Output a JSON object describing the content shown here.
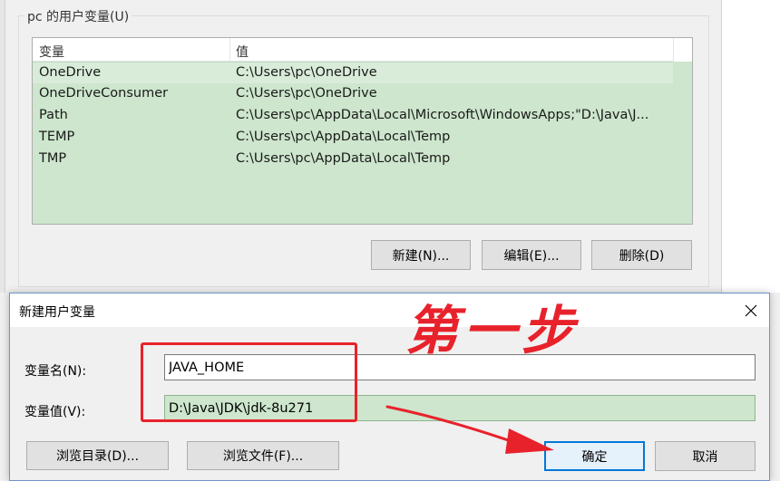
{
  "background_window": {
    "group_title": "pc 的用户变量(U)",
    "columns": {
      "name": "变量",
      "value": "值"
    },
    "rows": [
      {
        "name": "OneDrive",
        "value": "C:\\Users\\pc\\OneDrive",
        "selected": true
      },
      {
        "name": "OneDriveConsumer",
        "value": "C:\\Users\\pc\\OneDrive"
      },
      {
        "name": "Path",
        "value": "C:\\Users\\pc\\AppData\\Local\\Microsoft\\WindowsApps;\"D:\\Java\\J..."
      },
      {
        "name": "TEMP",
        "value": "C:\\Users\\pc\\AppData\\Local\\Temp"
      },
      {
        "name": "TMP",
        "value": "C:\\Users\\pc\\AppData\\Local\\Temp"
      }
    ],
    "buttons": {
      "new": "新建(N)...",
      "edit": "编辑(E)...",
      "delete": "删除(D)"
    }
  },
  "dialog": {
    "title": "新建用户变量",
    "name_label": "变量名(N):",
    "name_value": "JAVA_HOME",
    "value_label": "变量值(V):",
    "value_value": "D:\\Java\\JDK\\jdk-8u271",
    "buttons": {
      "browse_dir": "浏览目录(D)...",
      "browse_file": "浏览文件(F)...",
      "ok": "确定",
      "cancel": "取消"
    }
  },
  "annotation": {
    "text": "第一步",
    "color": "#e8222b"
  },
  "colors": {
    "list_bg": "#cde6cd",
    "accent": "#0078d7"
  }
}
